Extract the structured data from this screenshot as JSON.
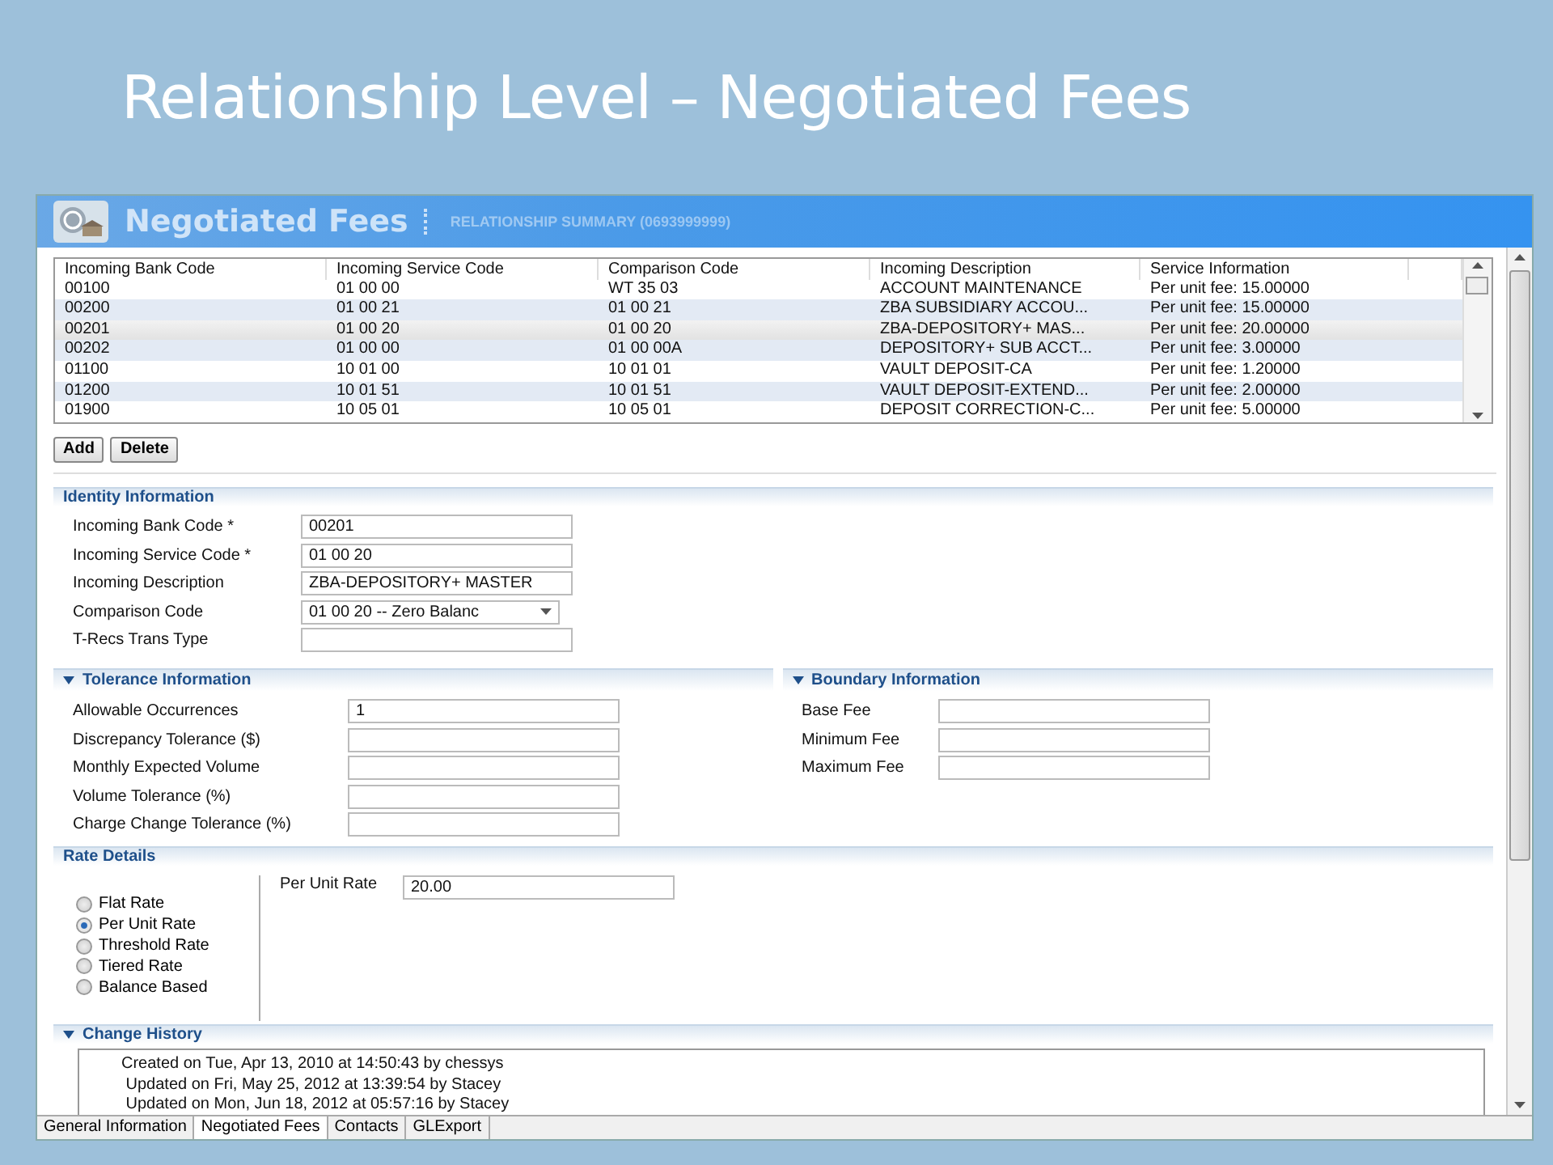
{
  "slide_title": "Relationship Level – Negotiated Fees",
  "window": {
    "title": "Negotiated Fees",
    "subtitle": "RELATIONSHIP SUMMARY (0693999999)"
  },
  "table": {
    "columns": [
      "Incoming Bank Code",
      "Incoming Service Code",
      "Comparison Code",
      "Incoming Description",
      "Service Information"
    ],
    "rows": [
      {
        "cells": [
          "00100",
          "01 00 00",
          "WT 35 03",
          "ACCOUNT MAINTENANCE",
          "Per unit fee: 15.00000"
        ],
        "selected": false
      },
      {
        "cells": [
          "00200",
          "01 00 21",
          "01 00 21",
          "ZBA SUBSIDIARY ACCOU...",
          "Per unit fee: 15.00000"
        ],
        "selected": false
      },
      {
        "cells": [
          "00201",
          "01 00 20",
          "01 00 20",
          "ZBA-DEPOSITORY+ MAS...",
          "Per unit fee: 20.00000"
        ],
        "selected": true
      },
      {
        "cells": [
          "00202",
          "01 00 00",
          "01 00 00A",
          "DEPOSITORY+ SUB ACCT...",
          "Per unit fee: 3.00000"
        ],
        "selected": false
      },
      {
        "cells": [
          "01100",
          "10 01 00",
          "10 01 01",
          "VAULT DEPOSIT-CA",
          "Per unit fee: 1.20000"
        ],
        "selected": false
      },
      {
        "cells": [
          "01200",
          "10 01 51",
          "10 01 51",
          "VAULT DEPOSIT-EXTEND...",
          "Per unit fee: 2.00000"
        ],
        "selected": false
      },
      {
        "cells": [
          "01900",
          "10 05 01",
          "10 05 01",
          "DEPOSIT CORRECTION-C...",
          "Per unit fee: 5.00000"
        ],
        "selected": false
      }
    ]
  },
  "buttons": [
    "Add",
    "Delete"
  ],
  "identity": {
    "title": "Identity Information",
    "fields": [
      {
        "label": "Incoming Bank Code *",
        "value": "00201",
        "kind": "text"
      },
      {
        "label": "Incoming Service Code *",
        "value": "01 00 20",
        "kind": "text"
      },
      {
        "label": "Incoming Description",
        "value": "ZBA-DEPOSITORY+ MASTER",
        "kind": "text"
      },
      {
        "label": "Comparison Code",
        "value": "01 00 20 -- Zero Balanc",
        "kind": "dropdown"
      },
      {
        "label": "T-Recs Trans Type",
        "kind": "text"
      }
    ]
  },
  "tolerance": {
    "title": "Tolerance Information",
    "expanded": true,
    "fields": [
      {
        "label": "Allowable Occurrences",
        "value": "1"
      },
      {
        "label": "Discrepancy Tolerance ($)"
      },
      {
        "label": "Monthly Expected Volume"
      },
      {
        "label": "Volume Tolerance (%)"
      },
      {
        "label": "Charge Change Tolerance (%)"
      }
    ]
  },
  "boundary": {
    "title": "Boundary Information",
    "expanded": true,
    "fields": [
      {
        "label": "Base Fee"
      },
      {
        "label": "Minimum Fee"
      },
      {
        "label": "Maximum Fee"
      }
    ]
  },
  "rate_details": {
    "title": "Rate Details",
    "options": [
      {
        "label": "Flat Rate",
        "selected": false
      },
      {
        "label": "Per Unit Rate",
        "selected": true
      },
      {
        "label": "Threshold Rate",
        "selected": false
      },
      {
        "label": "Tiered Rate",
        "selected": false
      },
      {
        "label": "Balance Based",
        "selected": false
      }
    ],
    "field": {
      "label": "Per Unit Rate",
      "value": "20.00"
    }
  },
  "change_history": {
    "title": "Change History",
    "expanded": true,
    "entries": [
      "Created on Tue, Apr 13, 2010 at 14:50:43 by chessys",
      " Updated on Fri, May 25, 2012 at 13:39:54 by Stacey",
      " Updated on Mon, Jun 18, 2012 at 05:57:16 by Stacey"
    ]
  },
  "tabs": [
    {
      "label": "General Information",
      "selected": false
    },
    {
      "label": "Negotiated Fees",
      "selected": true
    },
    {
      "label": "Contacts",
      "selected": false
    },
    {
      "label": "GLExport",
      "selected": false
    }
  ]
}
